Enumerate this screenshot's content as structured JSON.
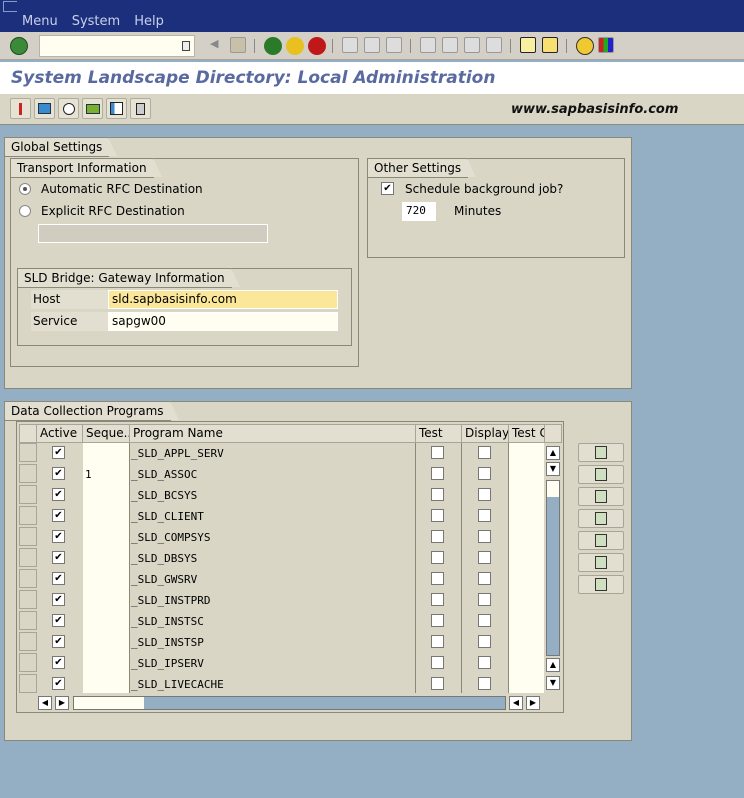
{
  "menubar": {
    "items": [
      "Menu",
      "System",
      "Help"
    ]
  },
  "command_field": {
    "value": "",
    "placeholder": ""
  },
  "title": "System Landscape Directory: Local Administration",
  "watermark": "www.sapbasisinfo.com",
  "app_toolbar": {
    "icons": [
      "wizard-icon",
      "data-transfer-icon",
      "schedule-icon",
      "job-icon",
      "layout-icon",
      "delete-icon"
    ]
  },
  "global_settings": {
    "title": "Global Settings",
    "transport": {
      "title": "Transport Information",
      "options": [
        {
          "label": "Automatic RFC Destination",
          "selected": true
        },
        {
          "label": "Explicit RFC Destination",
          "selected": false
        }
      ],
      "rfc_destination_value": ""
    },
    "gateway": {
      "title": "SLD Bridge: Gateway Information",
      "host_label": "Host",
      "host_value": "sld.sapbasisinfo.com",
      "service_label": "Service",
      "service_value": "sapgw00"
    },
    "other": {
      "title": "Other Settings",
      "schedule_label": "Schedule background job?",
      "schedule_checked": true,
      "minutes_value": "720",
      "minutes_label": "Minutes"
    }
  },
  "data_collection": {
    "title": "Data Collection Programs",
    "columns": [
      "Active",
      "Seque...",
      "Program Name",
      "Test",
      "Display",
      "Test C"
    ],
    "rows": [
      {
        "active": true,
        "seq": "",
        "program": "_SLD_APPL_SERV",
        "test": false,
        "display": false
      },
      {
        "active": true,
        "seq": "1",
        "program": "_SLD_ASSOC",
        "test": false,
        "display": false
      },
      {
        "active": true,
        "seq": "",
        "program": "_SLD_BCSYS",
        "test": false,
        "display": false
      },
      {
        "active": true,
        "seq": "",
        "program": "_SLD_CLIENT",
        "test": false,
        "display": false
      },
      {
        "active": true,
        "seq": "",
        "program": "_SLD_COMPSYS",
        "test": false,
        "display": false
      },
      {
        "active": true,
        "seq": "",
        "program": "_SLD_DBSYS",
        "test": false,
        "display": false
      },
      {
        "active": true,
        "seq": "",
        "program": "_SLD_GWSRV",
        "test": false,
        "display": false
      },
      {
        "active": true,
        "seq": "",
        "program": "_SLD_INSTPRD",
        "test": false,
        "display": false
      },
      {
        "active": true,
        "seq": "",
        "program": "_SLD_INSTSC",
        "test": false,
        "display": false
      },
      {
        "active": true,
        "seq": "",
        "program": "_SLD_INSTSP",
        "test": false,
        "display": false
      },
      {
        "active": true,
        "seq": "",
        "program": "_SLD_IPSERV",
        "test": false,
        "display": false
      },
      {
        "active": true,
        "seq": "",
        "program": "_SLD_LIVECACHE",
        "test": false,
        "display": false
      }
    ],
    "side_buttons": [
      "delete-row-icon",
      "insert-row-icon",
      "move-icon",
      "details-icon",
      "display-icon",
      "configure-icon",
      "select-icon"
    ]
  },
  "check": "✔"
}
